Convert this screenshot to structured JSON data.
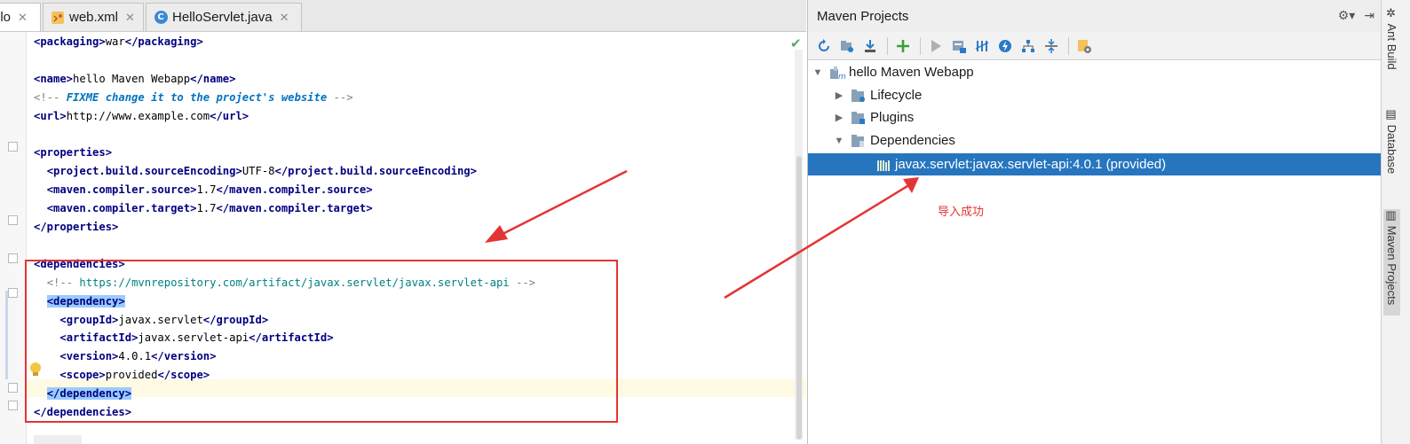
{
  "editor_tabs": [
    {
      "label": "llo",
      "active": true,
      "icon": "xml-file-icon"
    },
    {
      "label": "web.xml",
      "active": false,
      "icon": "xml-file-icon"
    },
    {
      "label": "HelloServlet.java",
      "active": false,
      "icon": "java-class-icon"
    }
  ],
  "code": {
    "lines": [
      {
        "indent": "",
        "parts": [
          [
            "t",
            "<packaging>"
          ],
          [
            "x",
            "war"
          ],
          [
            "t",
            "</packaging>"
          ]
        ]
      },
      {
        "indent": "",
        "parts": []
      },
      {
        "indent": "",
        "parts": [
          [
            "t",
            "<name>"
          ],
          [
            "x",
            "hello Maven Webapp"
          ],
          [
            "t",
            "</name>"
          ]
        ]
      },
      {
        "indent": "",
        "parts": [
          [
            "c",
            "<!-- "
          ],
          [
            "k",
            "FIXME change it to the project's website"
          ],
          [
            "c",
            " -->"
          ]
        ]
      },
      {
        "indent": "",
        "parts": [
          [
            "t",
            "<url>"
          ],
          [
            "x",
            "http://www.example.com"
          ],
          [
            "t",
            "</url>"
          ]
        ]
      },
      {
        "indent": "",
        "parts": []
      },
      {
        "indent": "",
        "parts": [
          [
            "t",
            "<properties>"
          ]
        ]
      },
      {
        "indent": "  ",
        "parts": [
          [
            "t",
            "<project.build.sourceEncoding>"
          ],
          [
            "x",
            "UTF-8"
          ],
          [
            "t",
            "</project.build.sourceEncoding>"
          ]
        ]
      },
      {
        "indent": "  ",
        "parts": [
          [
            "t",
            "<maven.compiler.source>"
          ],
          [
            "x",
            "1.7"
          ],
          [
            "t",
            "</maven.compiler.source>"
          ]
        ]
      },
      {
        "indent": "  ",
        "parts": [
          [
            "t",
            "<maven.compiler.target>"
          ],
          [
            "x",
            "1.7"
          ],
          [
            "t",
            "</maven.compiler.target>"
          ]
        ]
      },
      {
        "indent": "",
        "parts": [
          [
            "t",
            "</properties>"
          ]
        ]
      },
      {
        "indent": "",
        "parts": []
      },
      {
        "indent": "",
        "parts": [
          [
            "t",
            "<dependencies>"
          ]
        ]
      },
      {
        "indent": "  ",
        "parts": [
          [
            "c",
            "<!-- "
          ],
          [
            "u",
            "https://mvnrepository.com/artifact/javax.servlet/javax.servlet-api"
          ],
          [
            "c",
            " -->"
          ]
        ]
      },
      {
        "indent": "  ",
        "parts": [
          [
            "h",
            "<dependency>"
          ]
        ]
      },
      {
        "indent": "    ",
        "parts": [
          [
            "t",
            "<groupId>"
          ],
          [
            "x",
            "javax.servlet"
          ],
          [
            "t",
            "</groupId>"
          ]
        ]
      },
      {
        "indent": "    ",
        "parts": [
          [
            "t",
            "<artifactId>"
          ],
          [
            "x",
            "javax.servlet-api"
          ],
          [
            "t",
            "</artifactId>"
          ]
        ]
      },
      {
        "indent": "    ",
        "parts": [
          [
            "t",
            "<version>"
          ],
          [
            "x",
            "4.0.1"
          ],
          [
            "t",
            "</version>"
          ]
        ]
      },
      {
        "indent": "    ",
        "parts": [
          [
            "t",
            "<scope>"
          ],
          [
            "x",
            "provided"
          ],
          [
            "t",
            "</scope>"
          ]
        ]
      },
      {
        "indent": "  ",
        "parts": [
          [
            "h",
            "</dependency>"
          ]
        ]
      },
      {
        "indent": "",
        "parts": [
          [
            "t",
            "</dependencies>"
          ]
        ]
      }
    ]
  },
  "maven": {
    "title": "Maven Projects",
    "header_icons": [
      "gear-icon",
      "hide-icon"
    ],
    "toolbar": [
      "refresh-icon",
      "generate-sources-icon",
      "download-icon",
      "add-icon",
      "run-icon",
      "execute-goal-icon",
      "toggle-offline-icon",
      "skip-tests-icon",
      "show-dependencies-icon",
      "collapse-all-icon",
      "settings-icon"
    ],
    "tree": {
      "root": "hello Maven Webapp",
      "lifecycle": "Lifecycle",
      "plugins": "Plugins",
      "dependencies": "Dependencies",
      "dependency_item": "javax.servlet:javax.servlet-api:4.0.1 (provided)"
    },
    "annotation": "导入成功"
  },
  "side_tools": [
    "Ant Build",
    "Database",
    "Maven Projects"
  ],
  "colors": {
    "selection": "#2675bf",
    "annotation_red": "#e53434",
    "tag_blue": "#000080",
    "highlight": "#99ccff"
  }
}
